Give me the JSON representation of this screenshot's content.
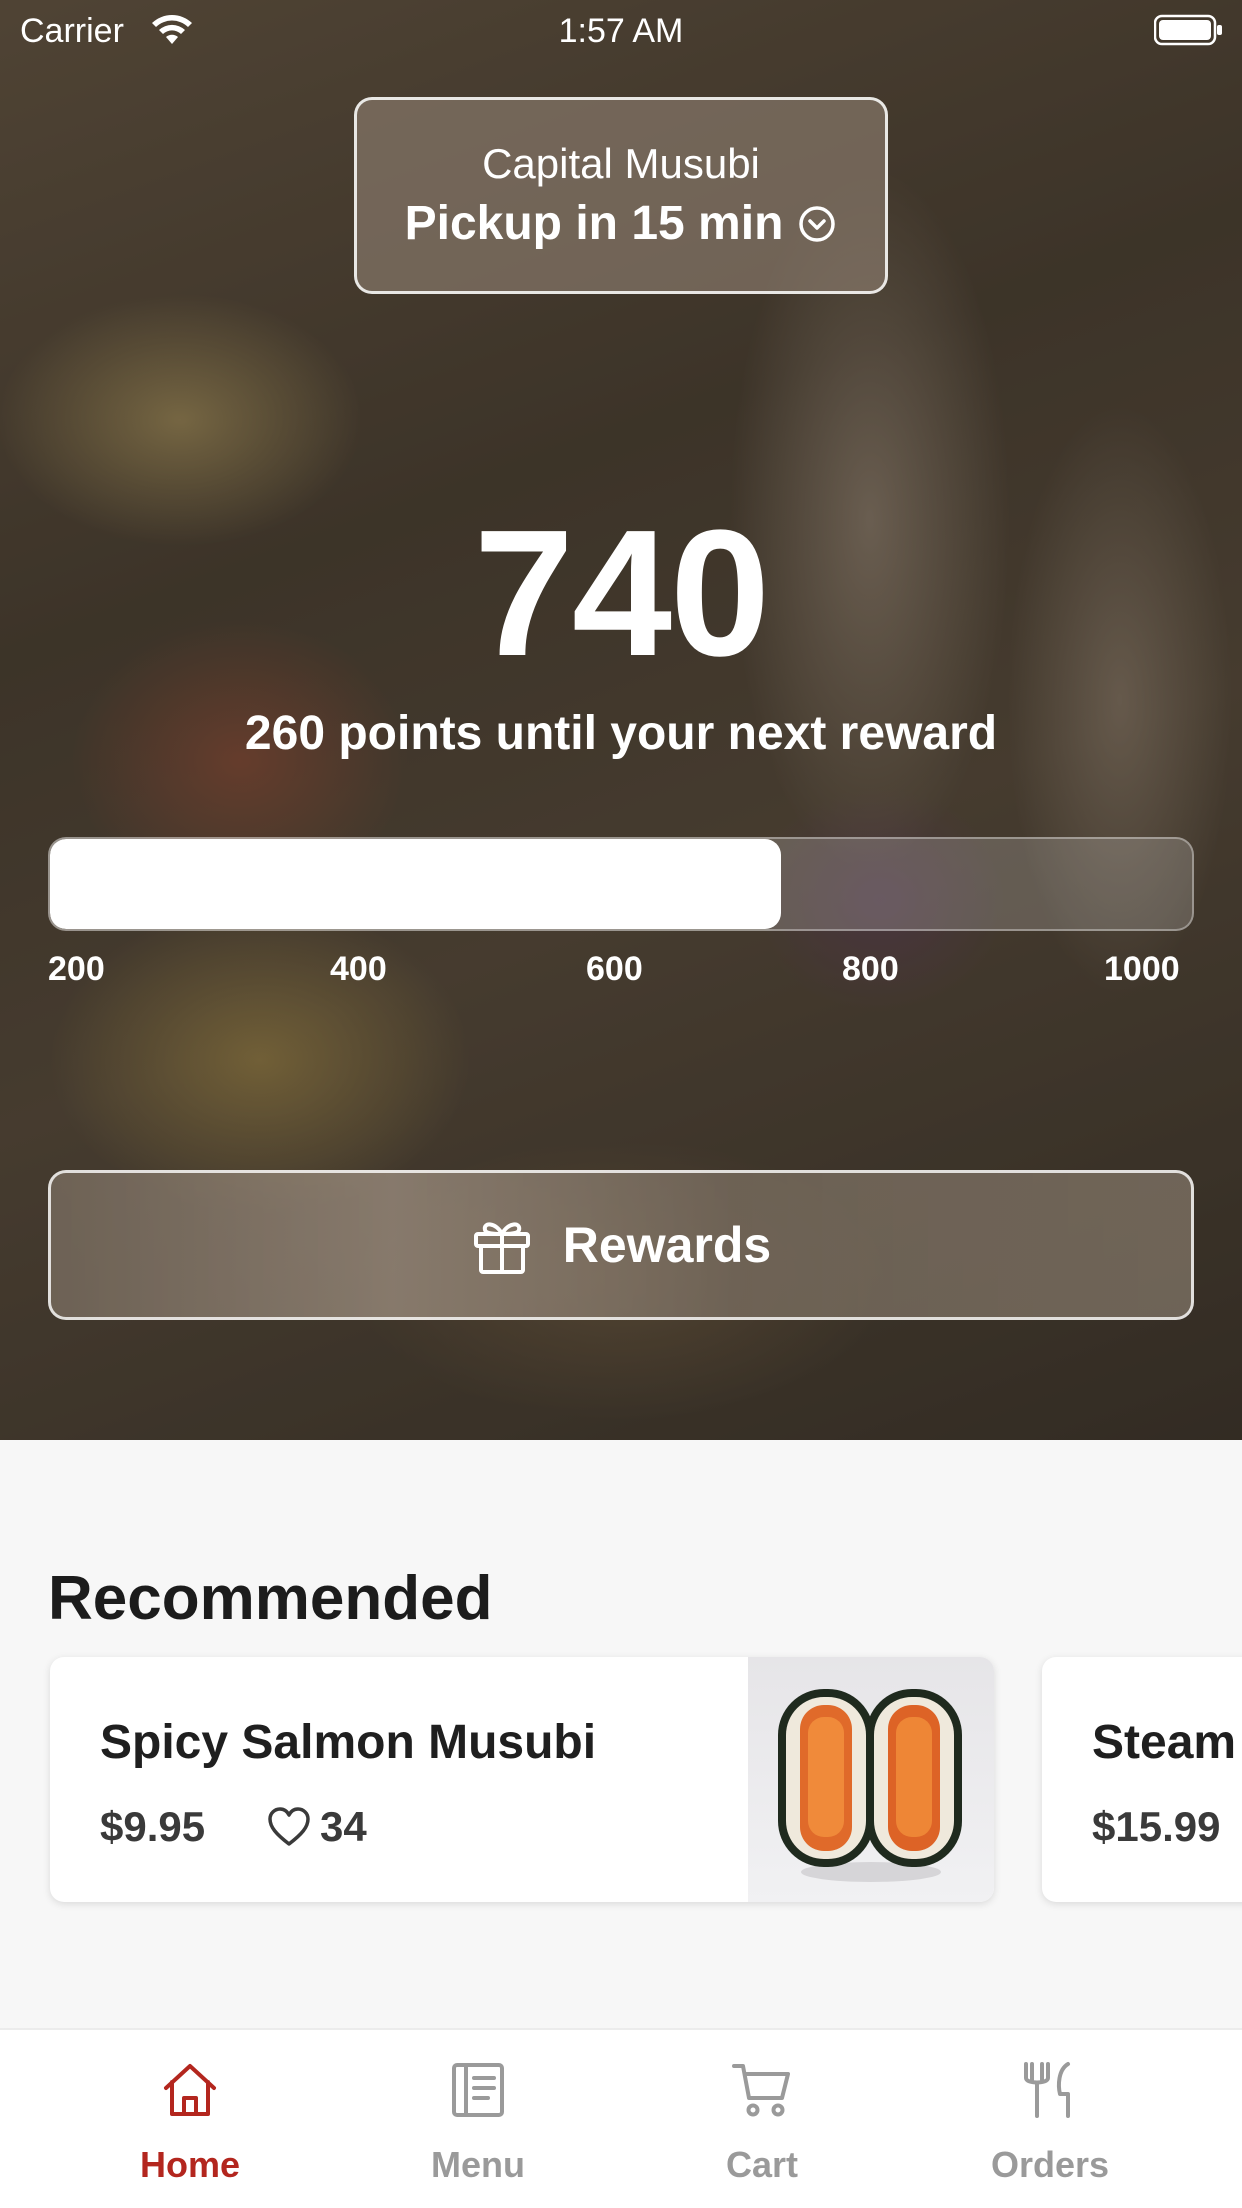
{
  "status_bar": {
    "carrier": "Carrier",
    "time": "1:57 AM"
  },
  "store": {
    "name": "Capital Musubi",
    "pickup": "Pickup in 15 min"
  },
  "points": {
    "value": "740",
    "caption": "260 points until your next reward",
    "progress_fraction": 0.64,
    "ticks": [
      "200",
      "400",
      "600",
      "800",
      "1000"
    ]
  },
  "rewards_button": {
    "label": "Rewards",
    "icon": "gift-icon"
  },
  "recommended": {
    "title": "Recommended",
    "items": [
      {
        "name": "Spicy Salmon Musubi",
        "price": "$9.95",
        "likes": "34"
      },
      {
        "name": "Steam",
        "price": "$15.99"
      }
    ]
  },
  "tabs": [
    {
      "label": "Home",
      "icon": "home-icon",
      "active": true
    },
    {
      "label": "Menu",
      "icon": "menu-icon",
      "active": false
    },
    {
      "label": "Cart",
      "icon": "cart-icon",
      "active": false
    },
    {
      "label": "Orders",
      "icon": "utensils-icon",
      "active": false
    }
  ],
  "colors": {
    "accent": "#b3261e",
    "inactive_tab": "#9a9a9a"
  }
}
